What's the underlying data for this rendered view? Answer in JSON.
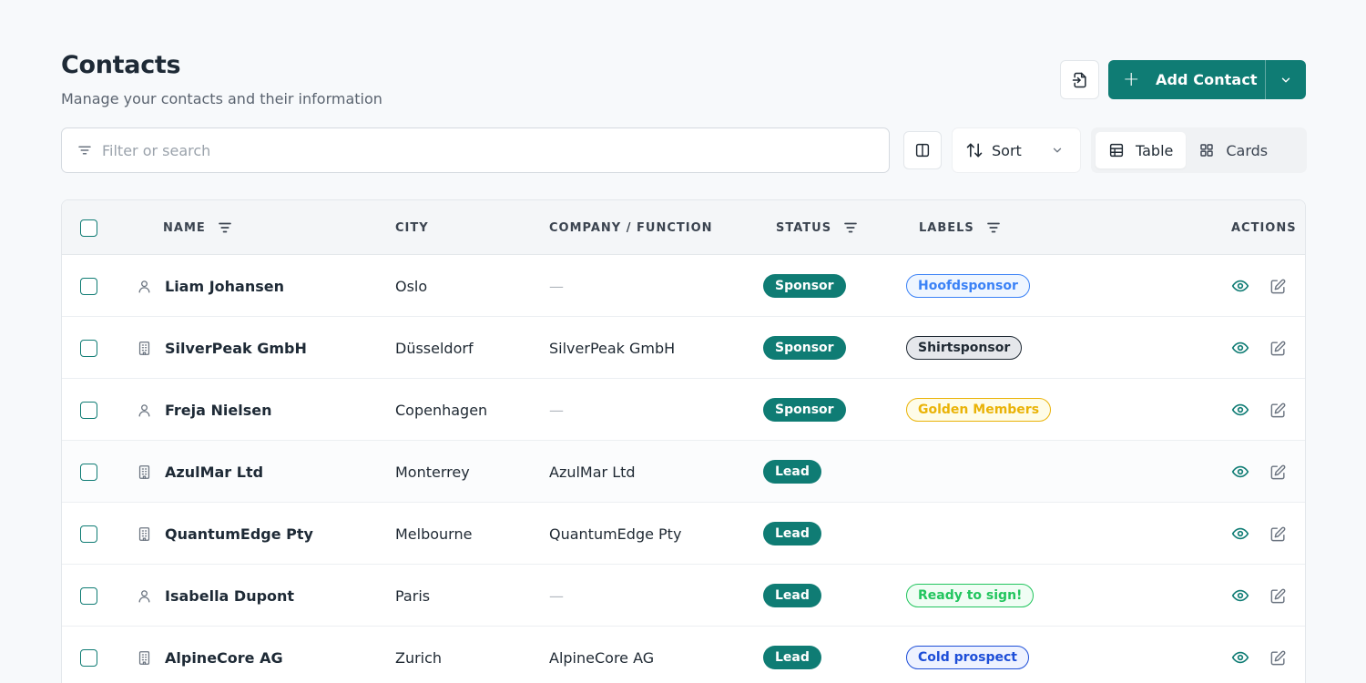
{
  "header": {
    "title": "Contacts",
    "subtitle": "Manage your contacts and their information",
    "add_label": "Add Contact"
  },
  "toolbar": {
    "search_placeholder": "Filter or search",
    "sort_label": "Sort",
    "view_table": "Table",
    "view_cards": "Cards",
    "active_view": "Table"
  },
  "colors": {
    "accent": "#0f7c74"
  },
  "table": {
    "columns": {
      "name": "NAME",
      "city": "CITY",
      "company": "COMPANY / FUNCTION",
      "status": "STATUS",
      "labels": "LABELS",
      "actions": "ACTIONS"
    },
    "rows": [
      {
        "type": "person-icon",
        "name": "Liam Johansen",
        "city": "Oslo",
        "company": "—",
        "status": "Sponsor",
        "label": "Hoofdsponsor",
        "label_color": "#3b82f6",
        "label_bg": "#eff6ff"
      },
      {
        "type": "building-icon",
        "name": "SilverPeak GmbH",
        "city": "Düsseldorf",
        "company": "SilverPeak GmbH",
        "status": "Sponsor",
        "label": "Shirtsponsor",
        "label_color": "#1f2933",
        "label_bg": "#e5e7eb"
      },
      {
        "type": "person-icon",
        "name": "Freja Nielsen",
        "city": "Copenhagen",
        "company": "—",
        "status": "Sponsor",
        "label": "Golden Members",
        "label_color": "#eab308",
        "label_bg": "#fefce8"
      },
      {
        "type": "building-icon",
        "name": "AzulMar Ltd",
        "city": "Monterrey",
        "company": "AzulMar Ltd",
        "status": "Lead",
        "label": "",
        "label_color": "",
        "label_bg": ""
      },
      {
        "type": "building-icon",
        "name": "QuantumEdge Pty",
        "city": "Melbourne",
        "company": "QuantumEdge Pty",
        "status": "Lead",
        "label": "",
        "label_color": "",
        "label_bg": ""
      },
      {
        "type": "person-icon",
        "name": "Isabella Dupont",
        "city": "Paris",
        "company": "—",
        "status": "Lead",
        "label": "Ready to sign!",
        "label_color": "#22c55e",
        "label_bg": "#f0fdf4"
      },
      {
        "type": "building-icon",
        "name": "AlpineCore AG",
        "city": "Zurich",
        "company": "AlpineCore AG",
        "status": "Lead",
        "label": "Cold prospect",
        "label_color": "#1d4ed8",
        "label_bg": "#eef2ff"
      }
    ]
  }
}
